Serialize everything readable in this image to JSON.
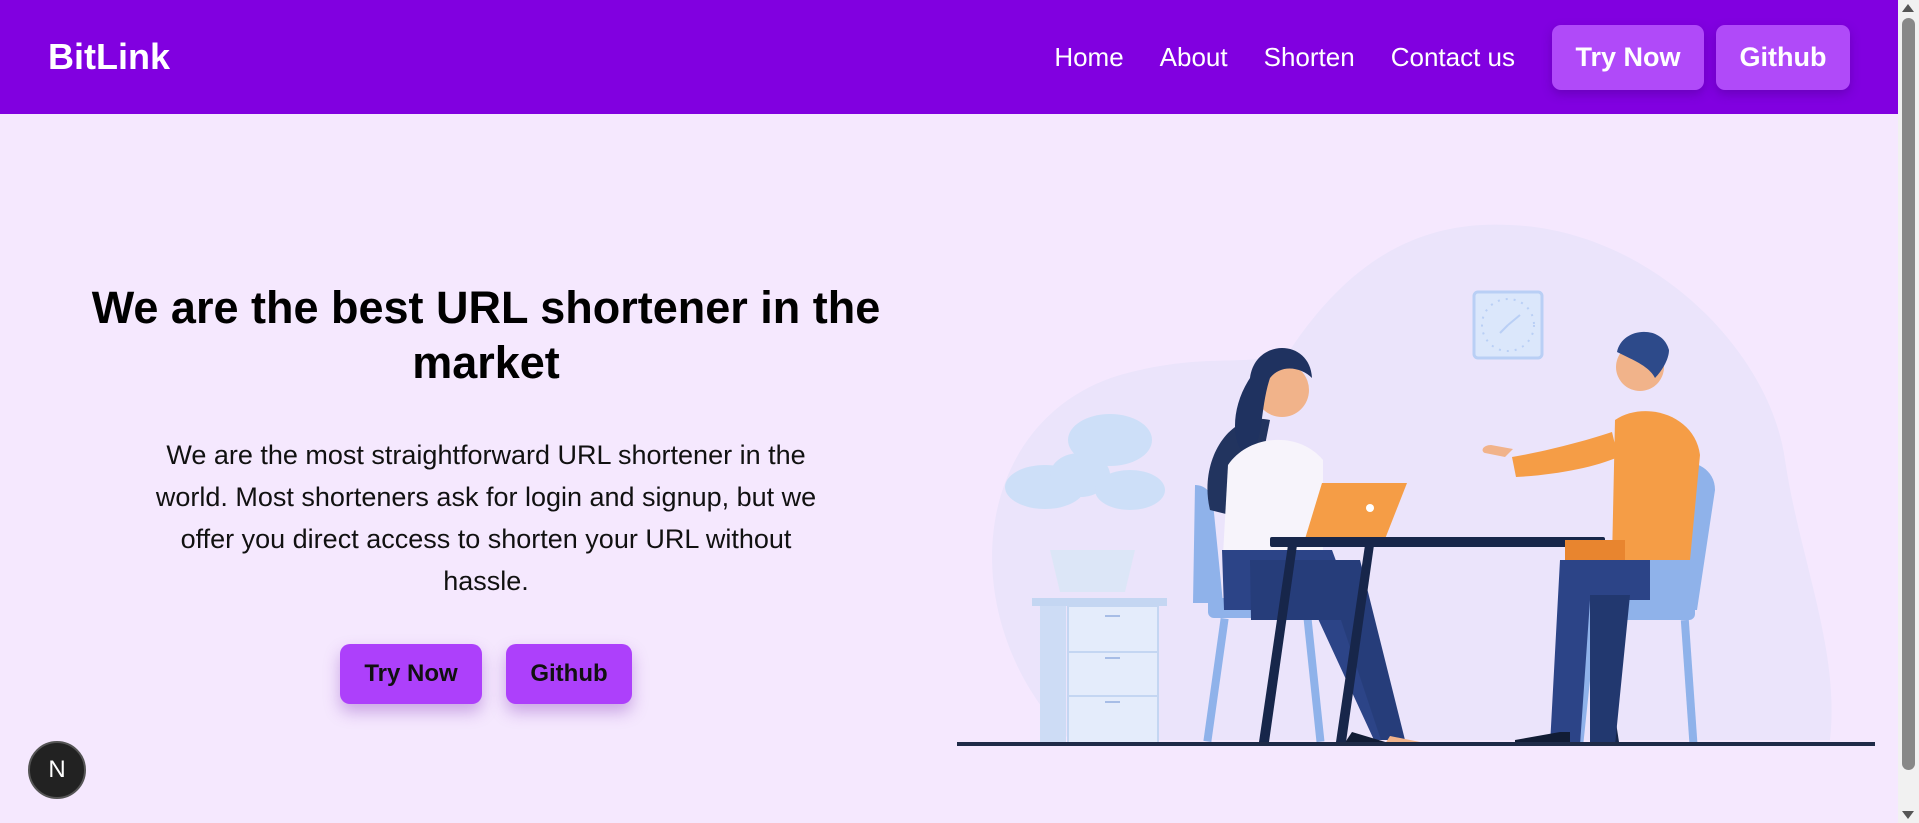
{
  "navbar": {
    "brand": "BitLink",
    "links": [
      {
        "label": "Home"
      },
      {
        "label": "About"
      },
      {
        "label": "Shorten"
      },
      {
        "label": "Contact us"
      }
    ],
    "try_now": "Try Now",
    "github": "Github"
  },
  "hero": {
    "title": "We are the best URL shortener in the market",
    "description": "We are the most straightforward URL shortener in the world. Most shorteners ask for login and signup, but we offer you direct access to shorten your URL without hassle.",
    "try_now": "Try Now",
    "github": "Github"
  },
  "badge": {
    "letter": "N"
  },
  "colors": {
    "navbar": "#8100e0",
    "page_bg": "#f5e8fe",
    "button": "#ad40fb"
  }
}
